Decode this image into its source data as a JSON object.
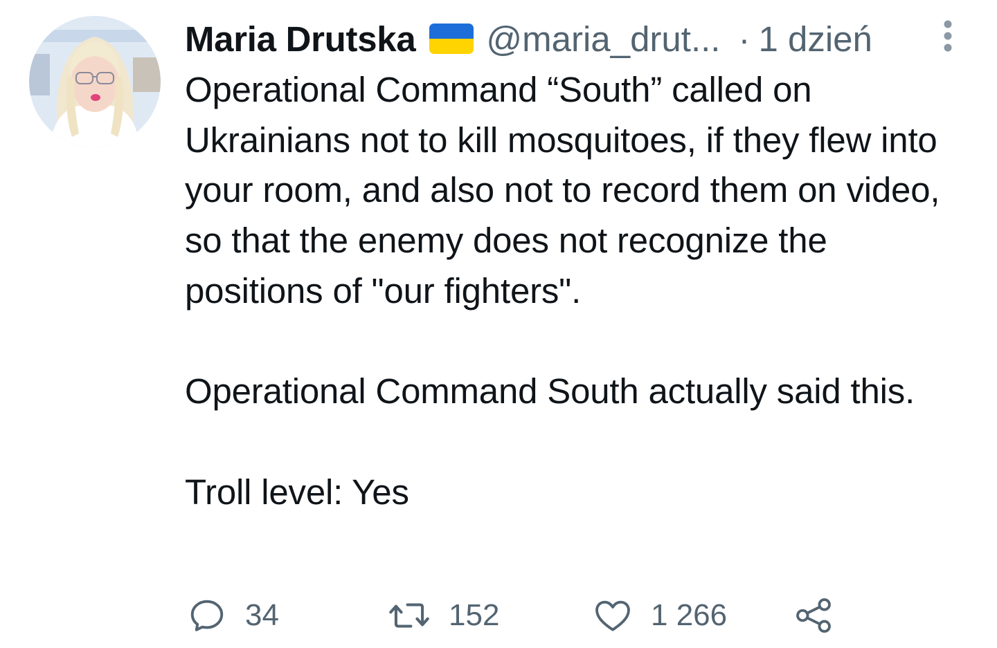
{
  "tweet": {
    "author": {
      "name": "Maria Drutska",
      "handle": "@maria_drut...",
      "flag_icon": "ukraine-flag-icon",
      "flag_colors": [
        "#1d6ed8",
        "#ffd400"
      ]
    },
    "separator": "·",
    "time": "1 dzień",
    "more_icon": "more-vertical-icon",
    "text": "Operational Command “South” called on Ukrainians not to kill mosquitoes, if they flew into your room, and also not to record them on video, so that the enemy does not recognize the positions of \"our fighters\".\n\nOperational Command South actually said this.\n\nTroll level: Yes",
    "actions": {
      "reply": {
        "icon": "reply-icon",
        "count": "34"
      },
      "retweet": {
        "icon": "retweet-icon",
        "count": "152"
      },
      "like": {
        "icon": "heart-icon",
        "count": "1 266"
      },
      "share": {
        "icon": "share-icon"
      }
    }
  },
  "colors": {
    "text_primary": "#0f1419",
    "text_secondary": "#536471",
    "background": "#ffffff"
  }
}
